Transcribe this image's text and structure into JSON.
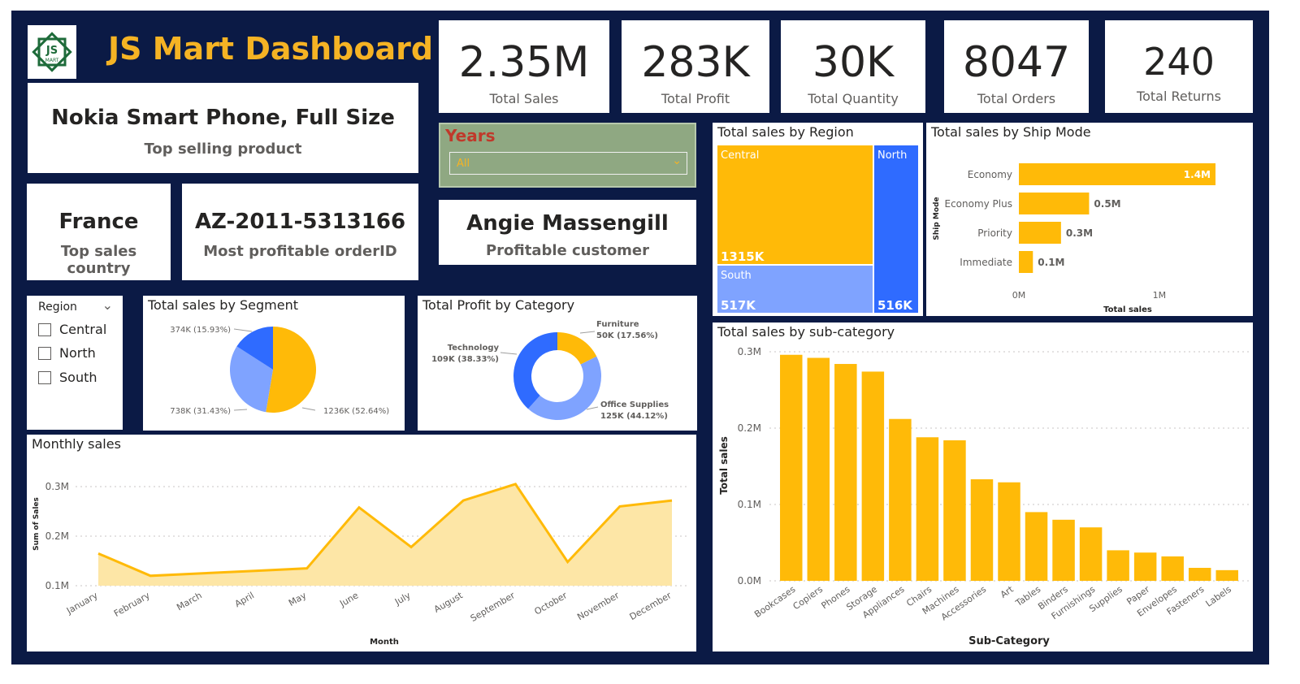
{
  "header": {
    "title": "JS Mart Dashboard",
    "logo_text": "JS",
    "logo_subtext": "MART"
  },
  "kpis": [
    {
      "value": "2.35M",
      "label": "Total Sales"
    },
    {
      "value": "283K",
      "label": "Total Profit"
    },
    {
      "value": "30K",
      "label": "Total Quantity"
    },
    {
      "value": "8047",
      "label": "Total Orders"
    },
    {
      "value": "240",
      "label": "Total Returns"
    }
  ],
  "info_cards": {
    "top_product": {
      "value": "Nokia Smart Phone, Full Size",
      "label": "Top selling product"
    },
    "top_country": {
      "value": "France",
      "label": "Top sales country"
    },
    "top_order": {
      "value": "AZ-2011-5313166",
      "label": "Most profitable orderID"
    },
    "top_customer": {
      "value": "Angie Massengill",
      "label": "Profitable customer"
    }
  },
  "years_slicer": {
    "title": "Years",
    "selected": "All",
    "chevron": "⌄"
  },
  "region_slicer": {
    "title": "Region",
    "chevron": "⌄",
    "options": [
      "Central",
      "North",
      "South"
    ]
  },
  "colors": {
    "background": "#0b1a45",
    "accent_gold": "#f5b324",
    "bar": "#ffba08",
    "blue": "#2f6bff",
    "light_blue": "#7fa3ff",
    "area_fill": "#fde6a6"
  },
  "chart_data": [
    {
      "id": "segment",
      "type": "pie",
      "title": "Total sales by Segment",
      "slices": [
        {
          "value": 1236,
          "label": "1236K (52.64%)",
          "color": "#ffba08"
        },
        {
          "value": 738,
          "label": "738K (31.43%)",
          "color": "#7fa3ff"
        },
        {
          "value": 374,
          "label": "374K (15.93%)",
          "color": "#2f6bff"
        }
      ]
    },
    {
      "id": "category",
      "type": "pie",
      "title": "Total Profit by Category",
      "donut": true,
      "slices": [
        {
          "value": 50,
          "name": "Furniture",
          "label": "50K (17.56%)",
          "color": "#ffba08"
        },
        {
          "value": 125,
          "name": "Office Supplies",
          "label": "125K (44.12%)",
          "color": "#7fa3ff"
        },
        {
          "value": 109,
          "name": "Technology",
          "label": "109K (38.33%)",
          "color": "#2f6bff"
        }
      ]
    },
    {
      "id": "region",
      "type": "heatmap",
      "title": "Total sales by Region",
      "tiles": [
        {
          "name": "Central",
          "label": "1315K",
          "value": 1315,
          "color": "#ffba08"
        },
        {
          "name": "South",
          "label": "517K",
          "value": 517,
          "color": "#7fa3ff"
        },
        {
          "name": "North",
          "label": "516K",
          "value": 516,
          "color": "#2f6bff"
        }
      ]
    },
    {
      "id": "shipmode",
      "type": "bar",
      "orientation": "horizontal",
      "title": "Total sales by Ship Mode",
      "categories": [
        "Economy",
        "Economy Plus",
        "Priority",
        "Immediate"
      ],
      "values": [
        1.4,
        0.5,
        0.3,
        0.1
      ],
      "value_labels": [
        "1.4M",
        "0.5M",
        "0.3M",
        "0.1M"
      ],
      "xlabel": "Total sales",
      "ylabel": "Ship Mode",
      "xticks": [
        "0M",
        "1M"
      ],
      "xlim": [
        0,
        1.4
      ]
    },
    {
      "id": "monthly",
      "type": "area",
      "title": "Monthly sales",
      "categories": [
        "January",
        "February",
        "March",
        "April",
        "May",
        "June",
        "July",
        "August",
        "September",
        "October",
        "November",
        "December"
      ],
      "values": [
        0.165,
        0.12,
        0.125,
        0.13,
        0.135,
        0.258,
        0.178,
        0.272,
        0.305,
        0.148,
        0.26,
        0.272
      ],
      "xlabel": "Month",
      "ylabel": "Sum of Sales",
      "yticks": [
        "0.1M",
        "0.2M",
        "0.3M"
      ],
      "ylim": [
        0.1,
        0.3
      ]
    },
    {
      "id": "subcategory",
      "type": "bar",
      "title": "Total sales by sub-category",
      "categories": [
        "Bookcases",
        "Copiers",
        "Phones",
        "Storage",
        "Appliances",
        "Chairs",
        "Machines",
        "Accessories",
        "Art",
        "Tables",
        "Binders",
        "Furnishings",
        "Supplies",
        "Paper",
        "Envelopes",
        "Fasteners",
        "Labels"
      ],
      "values": [
        0.296,
        0.292,
        0.284,
        0.274,
        0.212,
        0.188,
        0.184,
        0.133,
        0.129,
        0.09,
        0.08,
        0.07,
        0.04,
        0.037,
        0.032,
        0.017,
        0.014
      ],
      "xlabel": "Sub-Category",
      "ylabel": "Total sales",
      "yticks": [
        "0.0M",
        "0.1M",
        "0.2M",
        "0.3M"
      ],
      "ylim": [
        0,
        0.3
      ]
    }
  ]
}
